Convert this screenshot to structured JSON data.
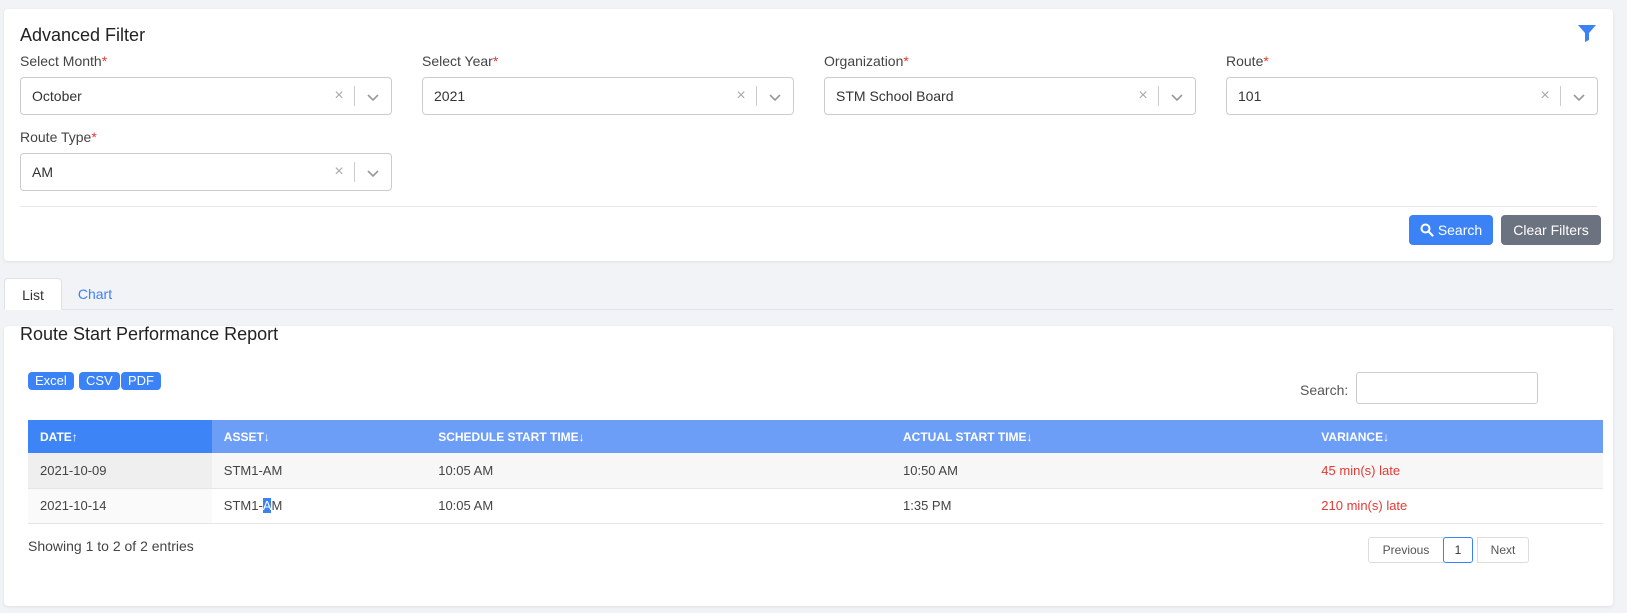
{
  "filter": {
    "title": "Advanced Filter",
    "icon": "filter-icon",
    "required_mark": "*",
    "fields": [
      {
        "label": "Select Month",
        "value": "October"
      },
      {
        "label": "Select Year",
        "value": "2021"
      },
      {
        "label": "Organization",
        "value": "STM School Board"
      },
      {
        "label": "Route",
        "value": "101"
      },
      {
        "label": "Route Type",
        "value": "AM"
      }
    ],
    "clear_glyph": "×",
    "search_label": "Search",
    "clear_filters_label": "Clear Filters"
  },
  "tabs": [
    {
      "label": "List",
      "active": true
    },
    {
      "label": "Chart",
      "active": false
    }
  ],
  "report": {
    "title": "Route Start Performance Report",
    "export_buttons": [
      "Excel",
      "CSV",
      "PDF"
    ],
    "search_label": "Search:",
    "search_value": "",
    "columns": [
      "DATE↑",
      "ASSET↓",
      "SCHEDULE START TIME↓",
      "ACTUAL START TIME↓",
      "VARIANCE↓"
    ],
    "rows": [
      {
        "date": "2021-10-09",
        "asset": "STM1-AM",
        "schedule": "10:05 AM",
        "actual": "10:50 AM",
        "variance": "45 min(s) late"
      },
      {
        "date": "2021-10-14",
        "asset_pre": "STM1-",
        "asset_hl": "A",
        "asset_post": "M",
        "schedule": "10:05 AM",
        "actual": "1:35 PM",
        "variance": "210 min(s) late"
      }
    ],
    "info": "Showing 1 to 2 of 2 entries",
    "pagination": {
      "previous": "Previous",
      "current": "1",
      "next": "Next"
    }
  },
  "colors": {
    "accent": "#3b82f6",
    "header": "#6c9ef8",
    "late": "#e53935",
    "secondary_button": "#6b7280"
  }
}
